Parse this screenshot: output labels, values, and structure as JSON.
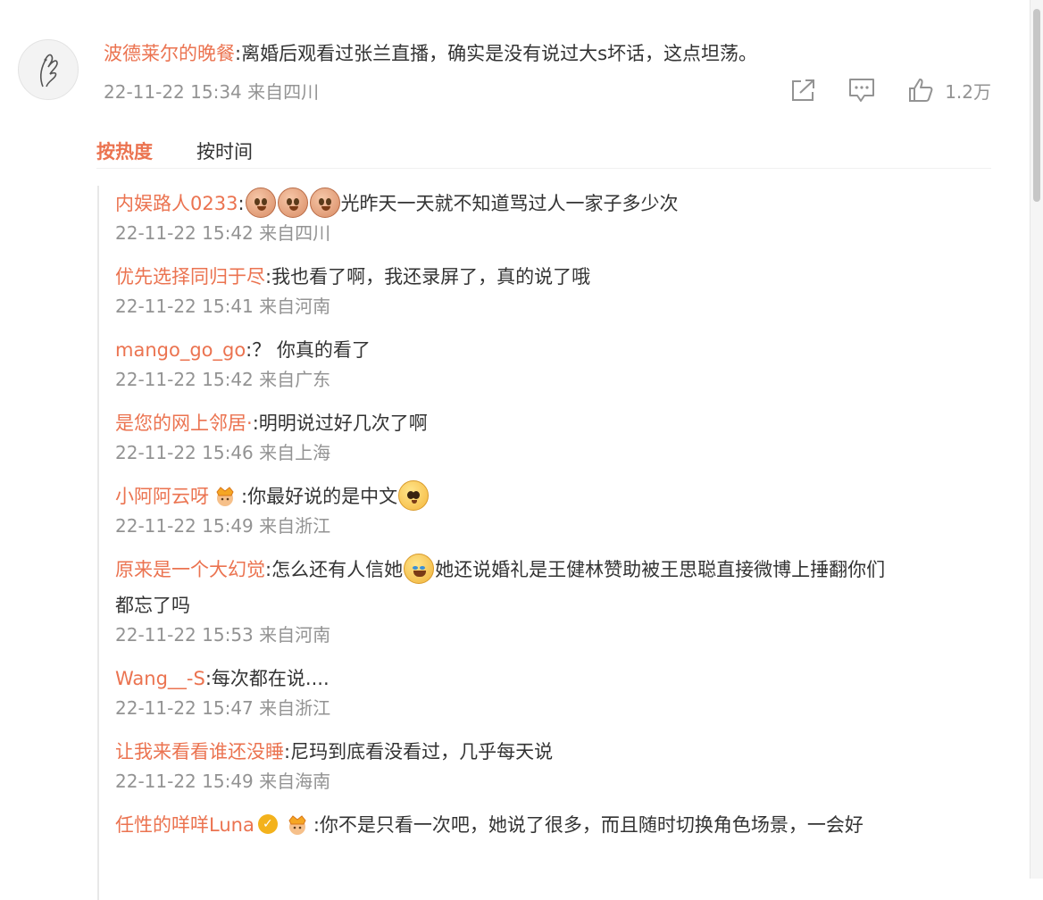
{
  "main_comment": {
    "username": "波德莱尔的晚餐",
    "text": ":离婚后观看过张兰直播，确实是没有说过大s坏话，这点坦荡。",
    "time": "22-11-22 15:34 来自四川",
    "like_count": "1.2万"
  },
  "icons": {
    "share": "share-icon",
    "comment": "comment-icon",
    "like": "thumbs-up-icon"
  },
  "tabs": [
    {
      "label": "按热度",
      "active": true
    },
    {
      "label": "按时间",
      "active": false
    }
  ],
  "replies": [
    {
      "username": "内娱路人0233",
      "text": "光昨天一天就不知道骂过人一家子多少次",
      "time": "22-11-22 15:42 来自四川"
    },
    {
      "username": "优先选择同归于尽",
      "text": ":我也看了啊，我还录屏了，真的说了哦",
      "time": "22-11-22 15:41 来自河南"
    },
    {
      "username": "mango_go_go",
      "text": ":？ 你真的看了",
      "time": "22-11-22 15:42 来自广东"
    },
    {
      "username": "是您的网上邻居·",
      "text": ":明明说过好几次了啊",
      "time": "22-11-22 15:46 来自上海"
    },
    {
      "username": "小阿阿云呀",
      "text": ":你最好说的是中文",
      "time": "22-11-22 15:49 来自浙江"
    },
    {
      "username": "原来是一个大幻觉",
      "text_before": ":怎么还有人信她",
      "text_after": "她还说婚礼是王健林赞助被王思聪直接微博上捶翻你们",
      "text_line2": "都忘了吗",
      "time": "22-11-22 15:53 来自河南"
    },
    {
      "username": "Wang__-S",
      "text": ":每次都在说....",
      "time": "22-11-22 15:47 来自浙江"
    },
    {
      "username": "让我来看看谁还没睡",
      "text": ":尼玛到底看没看过，几乎每天说",
      "time": "22-11-22 15:49 来自海南"
    },
    {
      "username": "任性的咩咩Luna",
      "text": ":你不是只看一次吧，她说了很多，而且随时切换角色场景，一会好"
    }
  ],
  "colors": {
    "username": "#eb7350",
    "meta": "#939393",
    "text": "#333333"
  }
}
